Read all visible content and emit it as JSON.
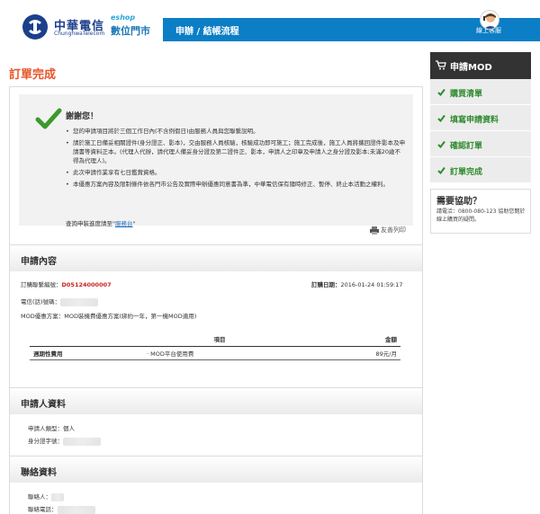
{
  "header": {
    "brand_zh": "中華電信",
    "brand_en": "ChunghwaTelecom",
    "eshop_tag": "eshop",
    "eshop_name": "數位門市",
    "nav_title": "申辦 / 結帳流程",
    "online_service": "線上客服"
  },
  "page": {
    "title": "訂單完成"
  },
  "thanks": {
    "title": "謝謝您！",
    "bullets": [
      "您的申請項目將於三個工作日內(不含例假日)由服務人員與您聯繫說明。",
      "請於施工日備妥相關證件(身分證正、影本)，交由服務人員核驗，核驗成功即可施工；施工完成後，施工人員將攜回證件影本及申請書等資料正本。(代理人代辦，請代理人備妥身分證及第二證件正、影本，申請人之印章及申請人之身分證及影本;未滿20歲不得為代理人)。",
      "此次申請作業享有七日鑑賞資格。",
      "本優惠方案內容及限制條件依各門市公告及實際申辦優惠同意書為準，中華電信保有隨時修正、暫停、終止本活動之權利。"
    ],
    "progress_text": "查詢申裝進度請至\"",
    "progress_link": "服務台",
    "progress_tail": "\"",
    "print_label": "友善列印"
  },
  "application": {
    "section_title": "申請內容",
    "order_no_label": "訂購聯繫編號：",
    "order_no": "D05124000007",
    "order_date_label": "訂購日期：",
    "order_date": "2016-01-24 01:59:17",
    "phone_label": "電信(話)號碼：",
    "plan_label": "MOD優惠方案：",
    "plan_value": "MOD裝機費優惠方案(綁約一年，第一機MOD適用)",
    "table": {
      "col_item": "項目",
      "col_amount": "金額",
      "rows": [
        {
          "category": "週期性費用",
          "item": "· MOD平台使用費",
          "amount": "89元/月"
        }
      ]
    }
  },
  "applicant": {
    "section_title": "申請人資料",
    "type_label": "申請人類型：",
    "type_value": "個人",
    "id_label": "身分證字號："
  },
  "contact": {
    "section_title": "聯絡資料",
    "person_label": "聯絡人：",
    "phone_label": "聯絡電話："
  },
  "sidebar": {
    "head": "申請MOD",
    "steps": [
      "購買清單",
      "填寫申請資料",
      "確認訂單",
      "訂單完成"
    ],
    "help_title": "需要協助？",
    "help_text": "請電洽：0800-080-123 協助您閱於線上購買的疑問。"
  },
  "colors": {
    "accent_orange": "#e8552a",
    "nav_blue": "#0b7ec6",
    "step_green": "#2e8b2e"
  }
}
